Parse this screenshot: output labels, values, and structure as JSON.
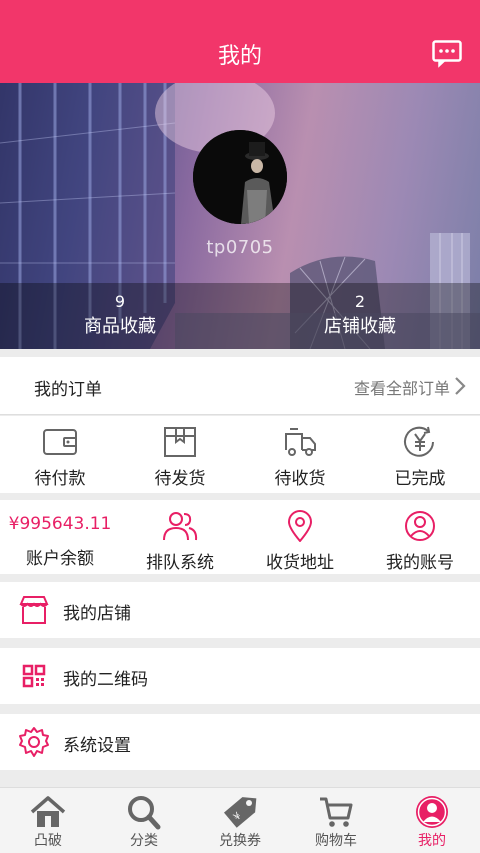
{
  "header": {
    "title": "我的",
    "message_icon": "message-icon"
  },
  "profile": {
    "username": "tp0705",
    "stats": [
      {
        "count": "9",
        "label": "商品收藏"
      },
      {
        "count": "2",
        "label": "店铺收藏"
      }
    ]
  },
  "orders": {
    "title": "我的订单",
    "view_all": "查看全部订单",
    "statuses": [
      {
        "label": "待付款",
        "icon": "wallet-icon"
      },
      {
        "label": "待发货",
        "icon": "package-icon"
      },
      {
        "label": "待收货",
        "icon": "truck-icon"
      },
      {
        "label": "已完成",
        "icon": "yuan-check-icon"
      }
    ]
  },
  "account": {
    "balance_value": "¥995643.11",
    "items": [
      {
        "label": "账户余额"
      },
      {
        "label": "排队系统",
        "icon": "users-icon"
      },
      {
        "label": "收货地址",
        "icon": "location-pin-icon"
      },
      {
        "label": "我的账号",
        "icon": "user-icon"
      }
    ]
  },
  "menu": [
    {
      "label": "我的店铺",
      "icon": "store-icon"
    },
    {
      "label": "我的二维码",
      "icon": "qrcode-icon"
    },
    {
      "label": "系统设置",
      "icon": "gear-icon"
    }
  ],
  "tabbar": {
    "active_index": 4,
    "items": [
      {
        "label": "凸破",
        "icon": "home-icon"
      },
      {
        "label": "分类",
        "icon": "search-icon"
      },
      {
        "label": "兑换券",
        "icon": "coupon-tag-icon"
      },
      {
        "label": "购物车",
        "icon": "cart-icon"
      },
      {
        "label": "我的",
        "icon": "profile-icon"
      }
    ]
  },
  "colors": {
    "brand": "#f2366a",
    "accent": "#e81f65"
  }
}
